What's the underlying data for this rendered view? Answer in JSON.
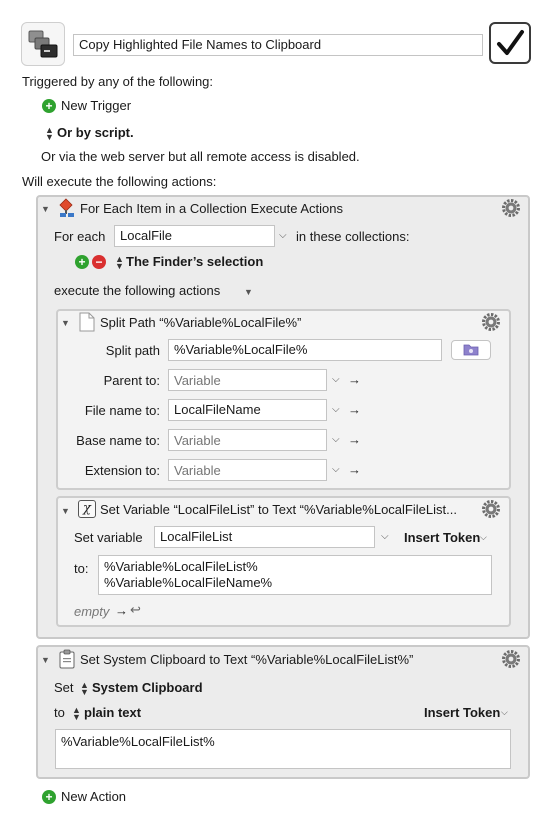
{
  "macro": {
    "name": "Copy Highlighted File Names to Clipboard",
    "enabled": true
  },
  "triggers": {
    "heading": "Triggered by any of the following:",
    "new_trigger_label": "New Trigger",
    "or_by_script": "Or by script.",
    "web_server_note": "Or via the web server but all remote access is disabled."
  },
  "actions_heading": "Will execute the following actions:",
  "for_each": {
    "title": "For Each Item in a Collection Execute Actions",
    "for_each_label": "For each",
    "variable_value": "LocalFile",
    "in_collections_label": "in these collections:",
    "collection": "The Finder’s selection",
    "execute_label": "execute the following actions",
    "split_path": {
      "title": "Split Path “%Variable%LocalFile%”",
      "split_path_label": "Split path",
      "split_path_value": "%Variable%LocalFile%",
      "rows": [
        {
          "label": "Parent to:",
          "value": "",
          "placeholder": "Variable"
        },
        {
          "label": "File name to:",
          "value": "LocalFileName",
          "placeholder": "Variable"
        },
        {
          "label": "Base name to:",
          "value": "",
          "placeholder": "Variable"
        },
        {
          "label": "Extension to:",
          "value": "",
          "placeholder": "Variable"
        }
      ]
    },
    "set_variable": {
      "title": "Set Variable “LocalFileList” to Text “%Variable%LocalFileList...",
      "set_variable_label": "Set variable",
      "variable_value": "LocalFileList",
      "insert_token_label": "Insert Token",
      "to_label": "to:",
      "text_lines": [
        "%Variable%LocalFileList%",
        "%Variable%LocalFileName%"
      ],
      "empty_label": "empty"
    }
  },
  "clipboard": {
    "title": "Set System Clipboard to Text “%Variable%LocalFileList%”",
    "set_label": "Set",
    "clipboard_value": "System Clipboard",
    "to_label": "to",
    "format_value": "plain text",
    "insert_token_label": "Insert Token",
    "text": "%Variable%LocalFileList%"
  },
  "new_action_label": "New Action",
  "colors": {
    "accent_green": "#2fa22f",
    "remove_red": "#d92f2f",
    "panel_bg": "#ececec"
  }
}
